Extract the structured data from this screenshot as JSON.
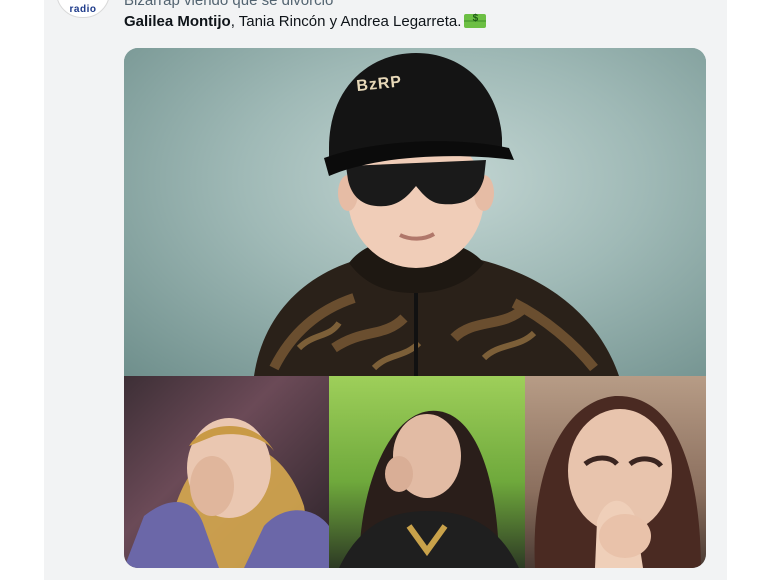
{
  "tweet": {
    "line1": "Bizarrap viendo que se divorció",
    "line2_bold": "Galilea Montijo",
    "line2_rest": ", Tania Rincón y Andrea Legarreta.",
    "emoji": "money-with-wings-icon"
  },
  "avatar": {
    "label": "radio"
  },
  "media": {
    "top_image": {
      "cap_text": "BzRP"
    }
  },
  "colors": {
    "name_text": "#0f1419",
    "muted_text": "#536471",
    "card_bg": "#f2f3f4"
  }
}
